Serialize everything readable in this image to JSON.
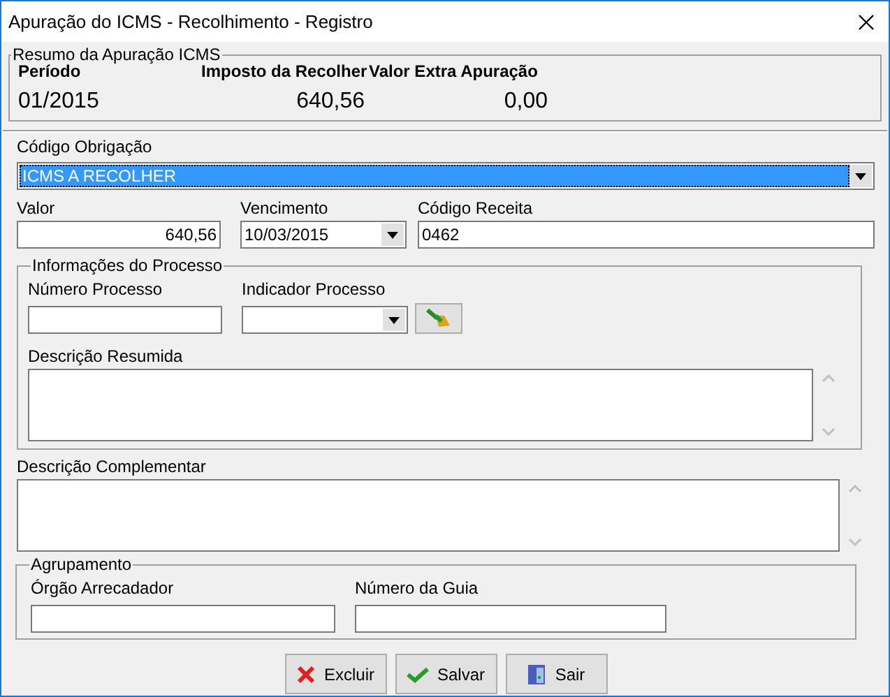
{
  "window": {
    "title": "Apuração do ICMS - Recolhimento - Registro"
  },
  "summary": {
    "legend": "Resumo da Apuração ICMS",
    "periodo_label": "Período",
    "imposto_label": "Imposto da Recolher",
    "extra_label": "Valor Extra Apuração",
    "periodo": "01/2015",
    "imposto": "640,56",
    "extra": "0,00"
  },
  "codigo_obrigacao": {
    "label": "Código Obrigação",
    "value": "ICMS A RECOLHER",
    "selected": true
  },
  "valor": {
    "label": "Valor",
    "value": "640,56"
  },
  "vencimento": {
    "label": "Vencimento",
    "value": "10/03/2015"
  },
  "codigo_receita": {
    "label": "Código Receita",
    "value": "0462"
  },
  "processo": {
    "legend": "Informações do Processo",
    "numero_label": "Número Processo",
    "indicador_label": "Indicador Processo",
    "descricao_label": "Descrição Resumida"
  },
  "descricao_complementar": {
    "label": "Descrição Complementar"
  },
  "agrupamento": {
    "legend": "Agrupamento",
    "orgao_label": "Órgão Arrecadador",
    "guia_label": "Número da Guia"
  },
  "buttons": [
    {
      "kind": "delete",
      "label": "Excluir"
    },
    {
      "kind": "save",
      "label": "Salvar"
    },
    {
      "kind": "exit",
      "label": "Sair"
    }
  ]
}
